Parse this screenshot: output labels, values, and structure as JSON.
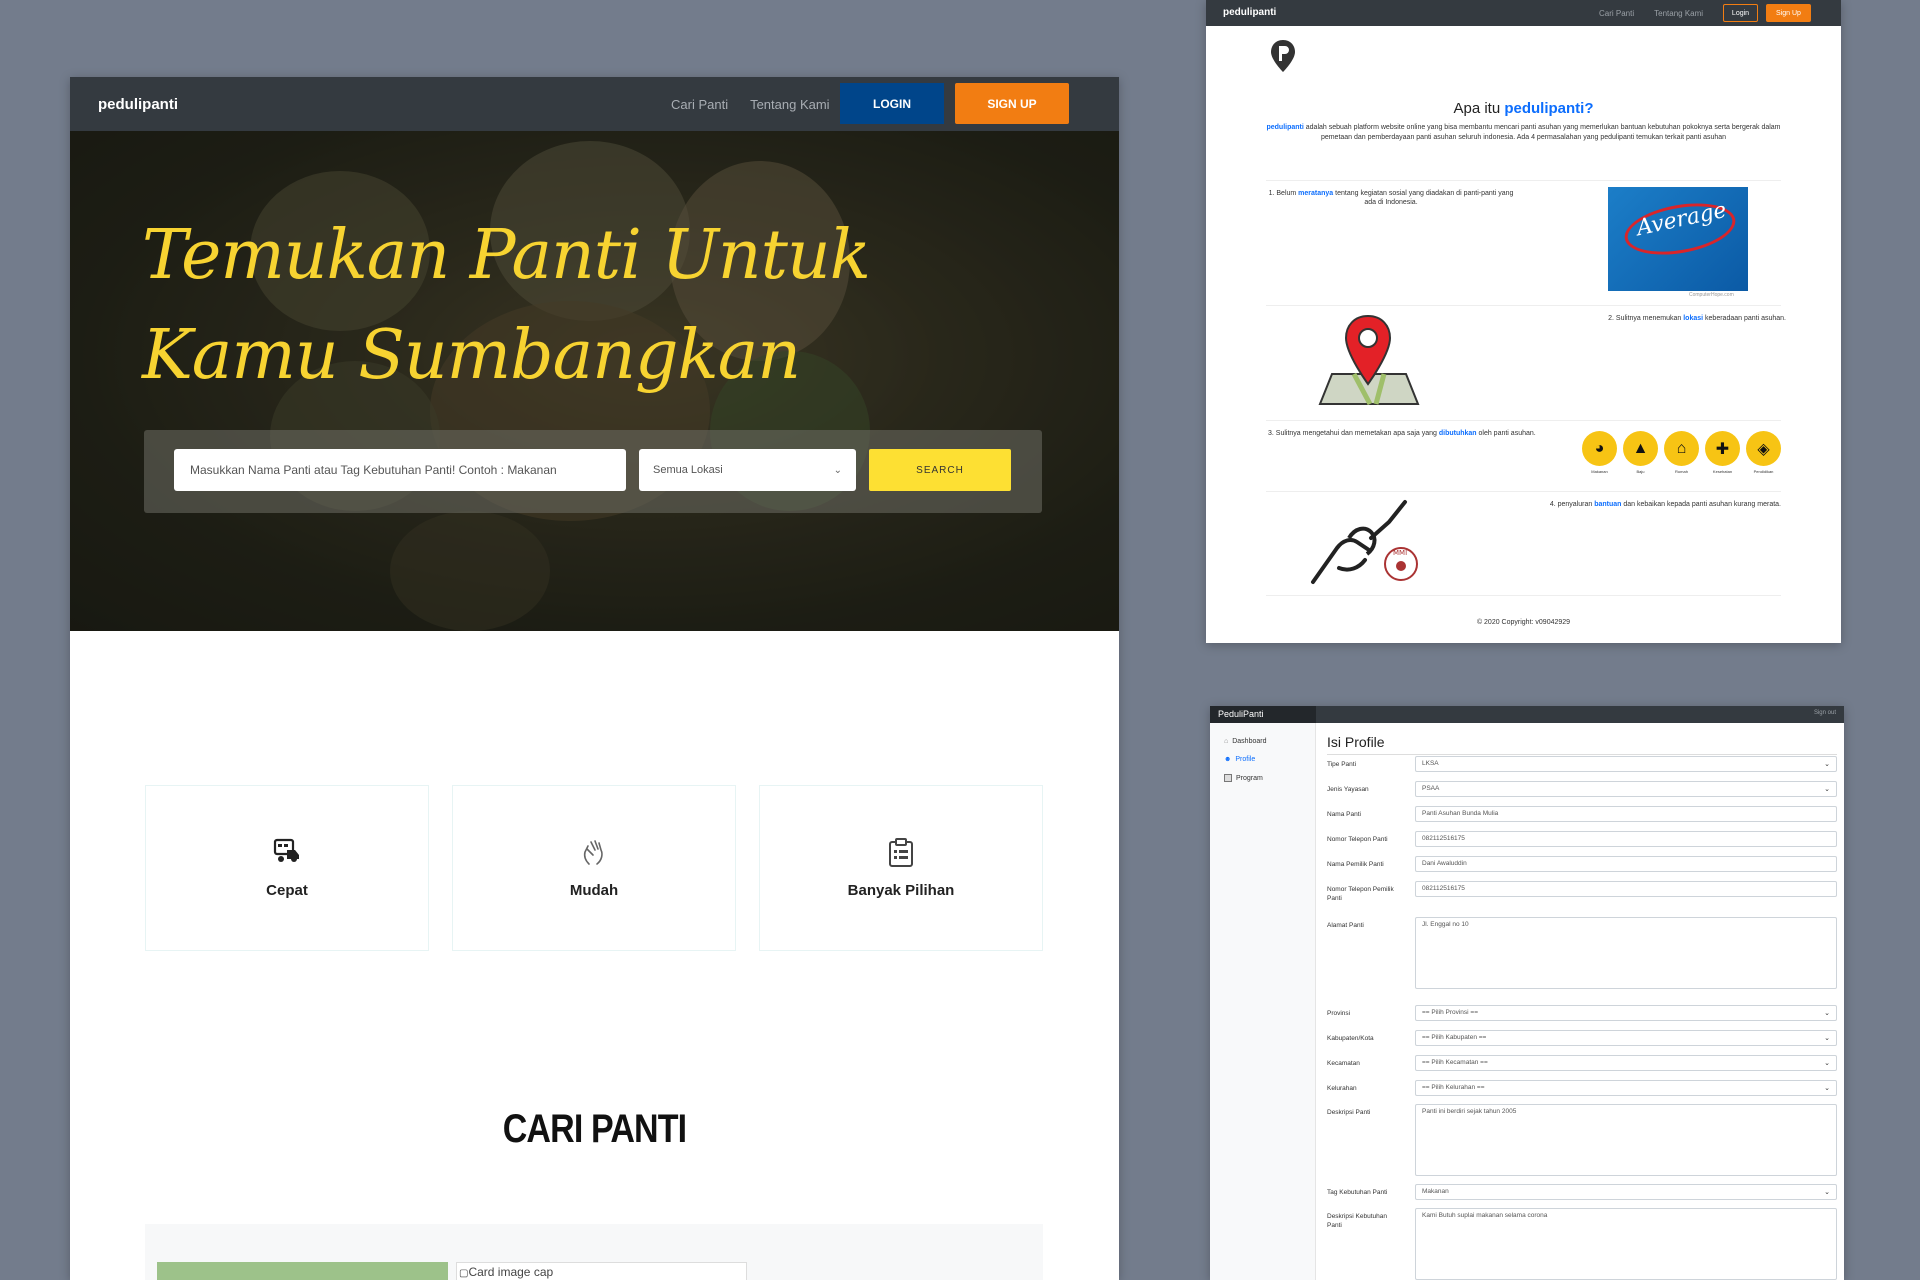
{
  "main": {
    "nav": {
      "brand": "pedulipanti",
      "links": [
        "Cari Panti",
        "Tentang Kami"
      ],
      "login": "LOGIN",
      "signup": "SIGN UP"
    },
    "hero": {
      "title_line1": "Temukan Panti Untuk",
      "title_line2": "Kamu Sumbangkan",
      "search_placeholder": "Masukkan Nama Panti atau Tag Kebutuhan Panti! Contoh : Makanan",
      "location_value": "Semua Lokasi",
      "search_button": "SEARCH"
    },
    "features": [
      {
        "label": "Cepat",
        "icon": "truck-icon"
      },
      {
        "label": "Mudah",
        "icon": "hand-icon"
      },
      {
        "label": "Banyak Pilihan",
        "icon": "clipboard-icon"
      }
    ],
    "section_title": "CARI PANTI",
    "card_alt": "Card image cap"
  },
  "about": {
    "nav": {
      "brand": "pedulipanti",
      "links": [
        "Cari Panti",
        "Tentang Kami"
      ],
      "login": "Login",
      "signup": "Sign Up"
    },
    "title_prefix": "Apa itu ",
    "title_brand": "pedulipanti?",
    "intro_brand": "pedulipanti",
    "intro_text": " adalah sebuah platform website online yang bisa membantu mencari panti asuhan yang memerlukan bantuan kebutuhan pokoknya serta bergerak dalam pemetaan dan pemberdayaan panti asuhan seluruh indonesia. Ada 4 permasalahan yang pedulipanti temukan terkait panti asuhan",
    "items": [
      {
        "before": "1. Belum ",
        "highlight": "meratanya",
        "after": " tentang kegiatan sosial yang diadakan di panti-panti yang ada di Indonesia."
      },
      {
        "before": "2. Sulitnya menemukan ",
        "highlight": "lokasi",
        "after": " keberadaan panti asuhan."
      },
      {
        "before": "3. Sulitnya mengetahui dan memetakan apa saja yang ",
        "highlight": "dibutuhkan",
        "after": " oleh panti asuhan."
      },
      {
        "before": "4. penyaluran ",
        "highlight": "bantuan",
        "after": " dan kebaikan kepada panti asuhan kurang merata."
      }
    ],
    "average_text": "Average",
    "image_credit": "ComputerHope.com",
    "need_icons": [
      {
        "label": "Makanan",
        "icon": "bowl-icon"
      },
      {
        "label": "Baju",
        "icon": "shirt-icon"
      },
      {
        "label": "Rumah",
        "icon": "house-icon"
      },
      {
        "label": "Kesehatan",
        "icon": "medkit-icon"
      },
      {
        "label": "Pendidikan",
        "icon": "graduation-icon"
      }
    ],
    "copyright": "© 2020 Copyright: v09042929"
  },
  "profile": {
    "brand": "PeduliPanti",
    "signout": "Sign out",
    "sidebar": [
      "Dashboard",
      "Profile",
      "Program"
    ],
    "title": "Isi Profile",
    "fields": [
      {
        "label": "Tipe Panti",
        "value": "LKSA",
        "type": "select"
      },
      {
        "label": "Jenis Yayasan",
        "value": "PSAA",
        "type": "select"
      },
      {
        "label": "Nama Panti",
        "value": "Panti Asuhan Bunda Mulia",
        "type": "input"
      },
      {
        "label": "Nomor Telepon Panti",
        "value": "082112516175",
        "type": "input"
      },
      {
        "label": "Nama Pemilik Panti",
        "value": "Dani Awaluddin",
        "type": "input"
      },
      {
        "label": "Nomor Telepon Pemilik Panti",
        "value": "082112516175",
        "type": "input"
      },
      {
        "label": "Alamat Panti",
        "value": "Jl. Enggal no 10",
        "type": "textarea"
      },
      {
        "label": "Provinsi",
        "value": "== Pilih Provinsi ==",
        "type": "select"
      },
      {
        "label": "Kabupaten/Kota",
        "value": "== Pilih Kabupaten ==",
        "type": "select"
      },
      {
        "label": "Kecamatan",
        "value": "== Pilih Kecamatan ==",
        "type": "select"
      },
      {
        "label": "Kelurahan",
        "value": "== Pilih Kelurahan ==",
        "type": "select"
      },
      {
        "label": "Deskripsi Panti",
        "value": "Panti ini berdiri sejak tahun 2005",
        "type": "textarea"
      },
      {
        "label": "Tag Kebutuhan Panti",
        "value": "Makanan",
        "type": "select"
      },
      {
        "label": "Deskripsi Kebutuhan Panti",
        "value": "Kami Butuh suplai makanan selama corona",
        "type": "textarea"
      }
    ]
  },
  "colors": {
    "page_bg": "#737c8c",
    "navbar": "#343a40",
    "login_blue": "#00458a",
    "signup_orange": "#f27d12",
    "hero_yellow": "#f7d331",
    "search_yellow": "#fde033",
    "link_blue": "#0d6efd"
  }
}
